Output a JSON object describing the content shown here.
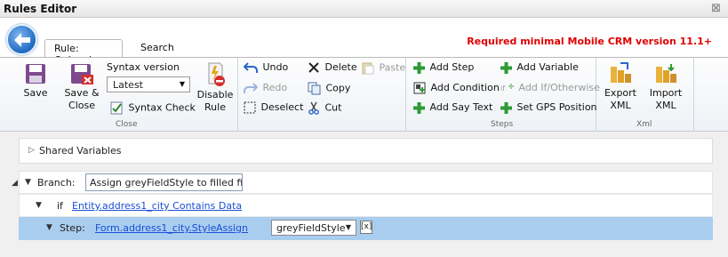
{
  "window": {
    "title": "Rules Editor",
    "close_glyph": "⊠"
  },
  "tabs": [
    {
      "label": "Rule: OnLoad",
      "active": true
    },
    {
      "label": "Search",
      "active": false
    }
  ],
  "version_message": "Required minimal Mobile CRM version 11.1+",
  "ribbon": {
    "close_group": {
      "label": "Close",
      "save": "Save",
      "save_close_line1": "Save &",
      "save_close_line2": "Close",
      "syntax_version_label": "Syntax version",
      "syntax_version_value": "Latest",
      "syntax_check": "Syntax Check",
      "disable_rule_line1": "Disable",
      "disable_rule_line2": "Rule"
    },
    "edit_group": {
      "undo": "Undo",
      "redo": "Redo",
      "deselect": "Deselect",
      "delete": "Delete",
      "copy": "Copy",
      "cut": "Cut",
      "paste": "Paste"
    },
    "steps_group": {
      "label": "Steps",
      "add_step": "Add Step",
      "add_condition": "Add Condition",
      "add_say_text": "Add Say Text",
      "add_variable": "Add Variable",
      "add_if_otherwise": "Add If/Otherwise",
      "set_gps_position": "Set GPS Position"
    },
    "xml_group": {
      "label": "Xml",
      "export_line1": "Export",
      "export_line2": "XML",
      "import_line1": "Import",
      "import_line2": "XML"
    }
  },
  "editor": {
    "shared_variables": "Shared Variables",
    "branch_label": "Branch:",
    "branch_name": "Assign greyFieldStyle to filled field",
    "if_keyword": "if",
    "condition": "Entity.address1_city Contains Data",
    "step_label": "Step:",
    "step_target": "Form.address1_city.Style",
    "step_action": "Assign",
    "step_value": "greyFieldStyle",
    "step_clear": "[x]"
  },
  "colors": {
    "version_message": "#e00000",
    "selected_row": "#a9cdef",
    "link": "#1a4fd6",
    "back_button": "#1f6bc2"
  },
  "icons": {
    "back": "back-arrow-icon",
    "save": "floppy-disk-icon",
    "save_close": "floppy-disk-close-icon",
    "syntax_check": "checklist-icon",
    "disable_rule": "disable-rule-icon",
    "undo": "undo-icon",
    "redo": "redo-icon",
    "deselect": "deselect-icon",
    "delete": "delete-x-icon",
    "copy": "copy-icon",
    "cut": "scissors-icon",
    "paste": "paste-icon",
    "add_step": "green-plus-icon",
    "add_condition": "condition-icon",
    "add_say_text": "green-plus-icon",
    "add_variable": "green-plus-icon",
    "add_if_otherwise": "if-otherwise-icon",
    "set_gps_position": "green-plus-icon",
    "export_xml": "export-xml-icon",
    "import_xml": "import-xml-icon"
  }
}
